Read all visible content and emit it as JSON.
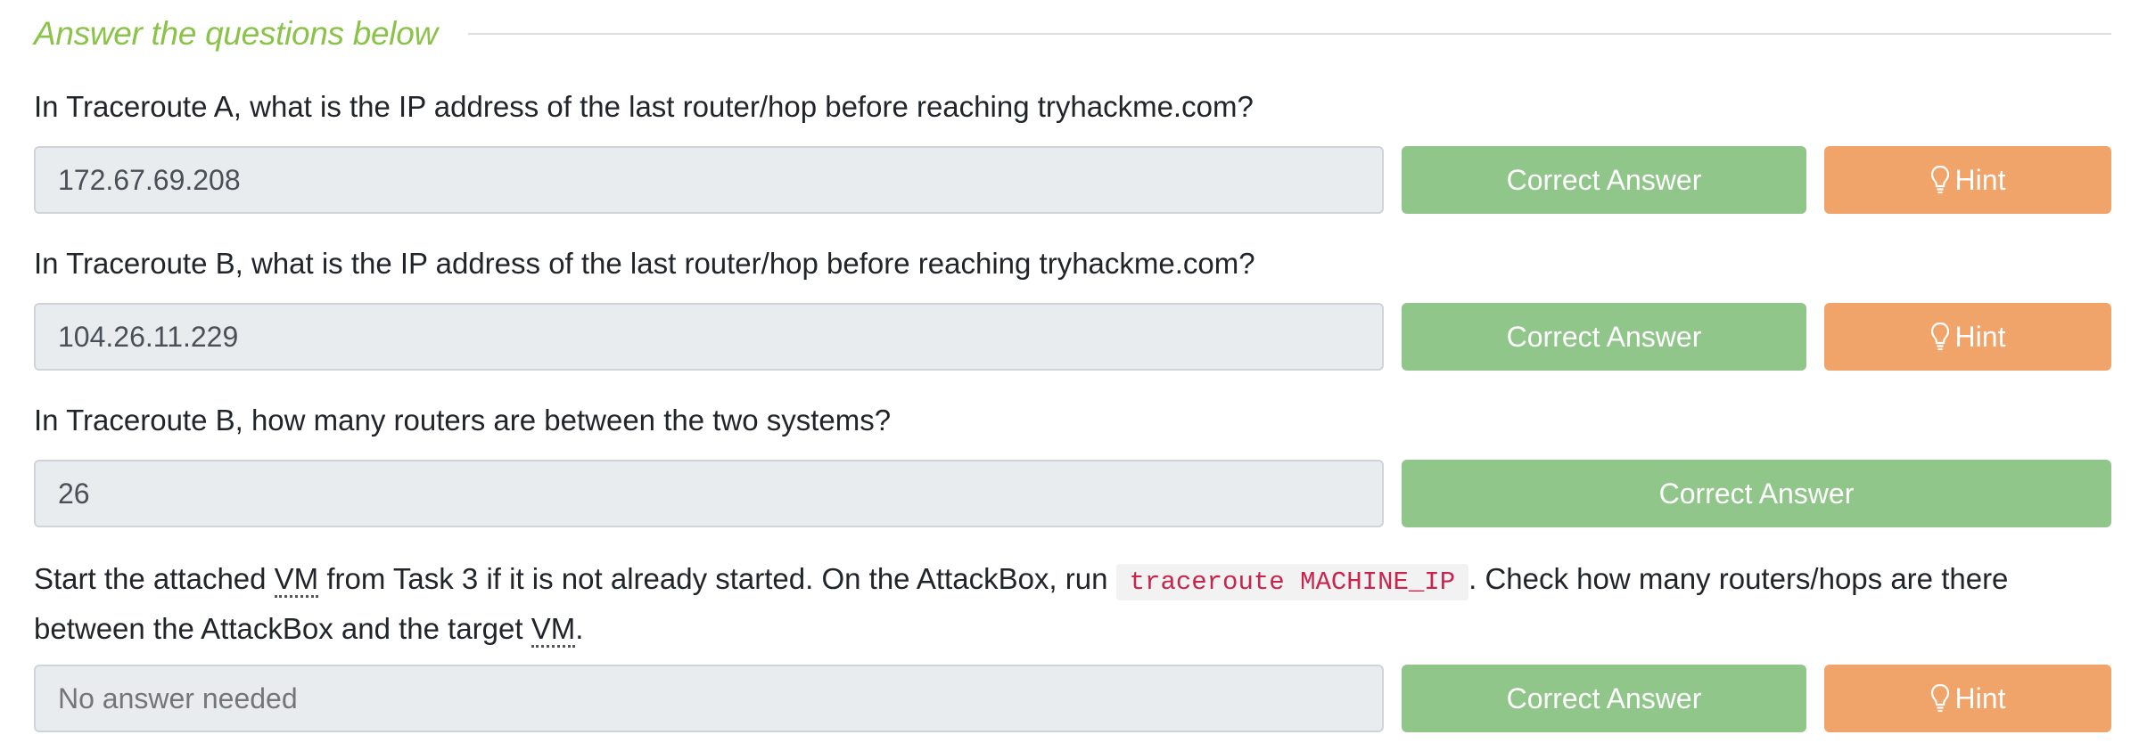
{
  "header": {
    "title": "Answer the questions below"
  },
  "questions": [
    {
      "text": "In Traceroute A, what is the IP address of the last router/hop before reaching tryhackme.com?",
      "answer": "172.67.69.208",
      "correct_label": "Correct Answer",
      "hint_label": "Hint"
    },
    {
      "text": "In Traceroute B, what is the IP address of the last router/hop before reaching tryhackme.com?",
      "answer": "104.26.11.229",
      "correct_label": "Correct Answer",
      "hint_label": "Hint"
    },
    {
      "text": "In Traceroute B, how many routers are between the two systems?",
      "answer": "26",
      "correct_label": "Correct Answer"
    },
    {
      "text_part1": "Start the attached ",
      "abbr1": "VM",
      "text_part2": " from Task 3 if it is not already started. On the AttackBox, run ",
      "code": "traceroute MACHINE_IP",
      "text_part3": ". Check how many routers/hops are there between the AttackBox and the target ",
      "abbr2": "VM",
      "text_part4": ".",
      "placeholder": "No answer needed",
      "correct_label": "Correct Answer",
      "hint_label": "Hint"
    }
  ],
  "colors": {
    "accent_title": "#8bc34a",
    "correct_button": "#91c68b",
    "hint_button": "#f0a46a",
    "code_text": "#c7254e"
  },
  "icons": {
    "hint": "lightbulb-icon"
  }
}
